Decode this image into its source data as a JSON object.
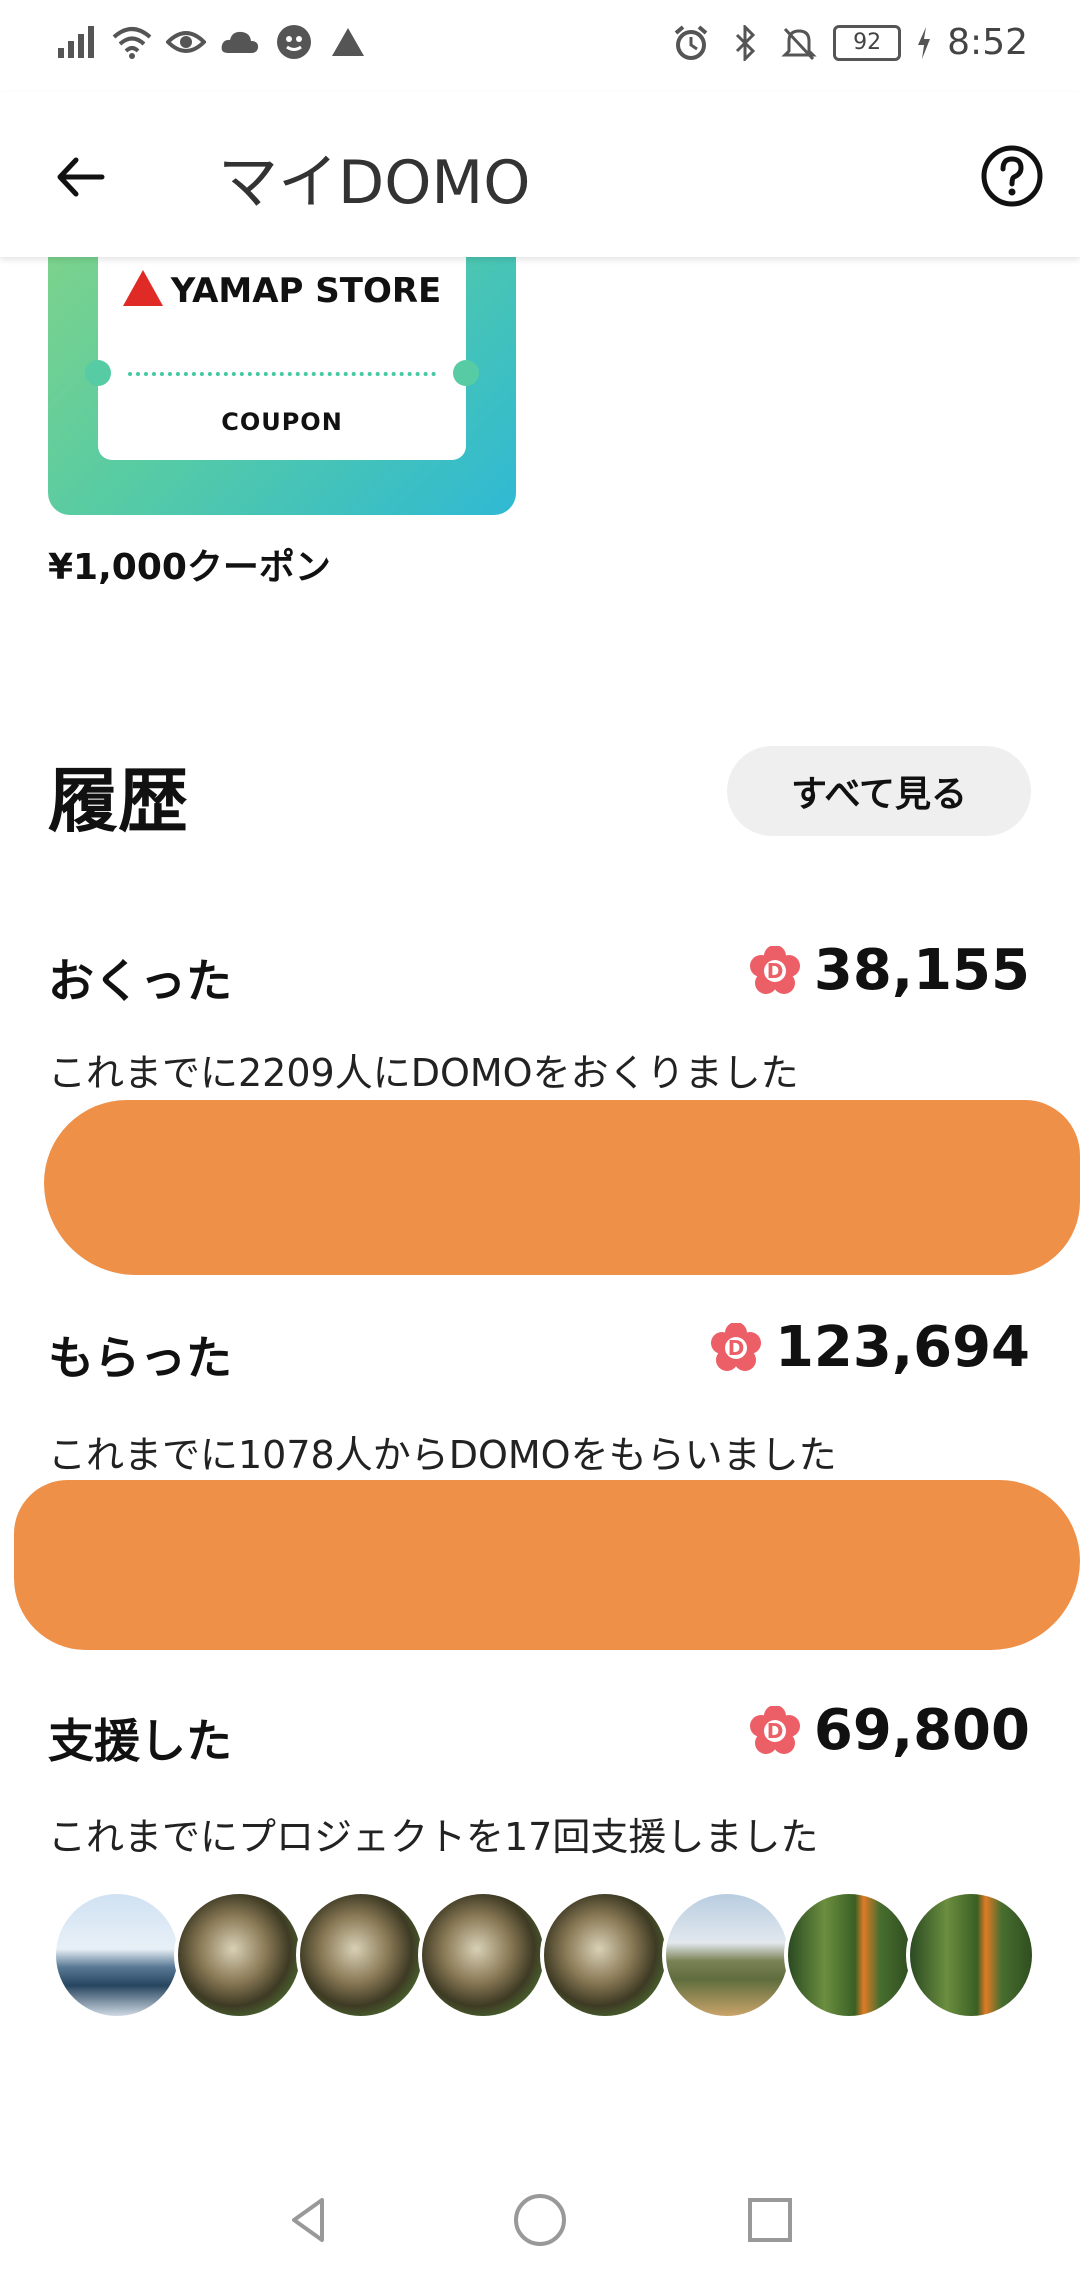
{
  "status_bar": {
    "battery": "92",
    "time": "8:52",
    "icons_left": [
      "signal-icon",
      "wifi-icon",
      "eye-icon",
      "cloud-icon",
      "app-icon",
      "triangle-icon"
    ],
    "icons_right": [
      "alarm-icon",
      "bluetooth-icon",
      "mute-icon",
      "battery-icon",
      "charging-icon"
    ]
  },
  "header": {
    "title": "マイDOMO"
  },
  "coupon": {
    "brand": "YAMAP STORE",
    "label": "COUPON",
    "caption": "¥1,000クーポン",
    "colors": {
      "start": "#7fd38a",
      "end": "#2fb9d4",
      "brand_mark": "#e02a25"
    }
  },
  "history": {
    "title": "履歴",
    "see_all": "すべて見る",
    "rows": [
      {
        "label": "おくった",
        "value": "38,155",
        "description": "これまでに2209人にDOMOをおくりました"
      },
      {
        "label": "もらった",
        "value": "123,694",
        "description": "これまでに1078人からDOMOをもらいました"
      },
      {
        "label": "支援した",
        "value": "69,800",
        "description": "これまでにプロジェクトを17回支援しました"
      }
    ]
  },
  "colors": {
    "accent_domo": "#ec5f67",
    "redaction": "#ef9048"
  }
}
